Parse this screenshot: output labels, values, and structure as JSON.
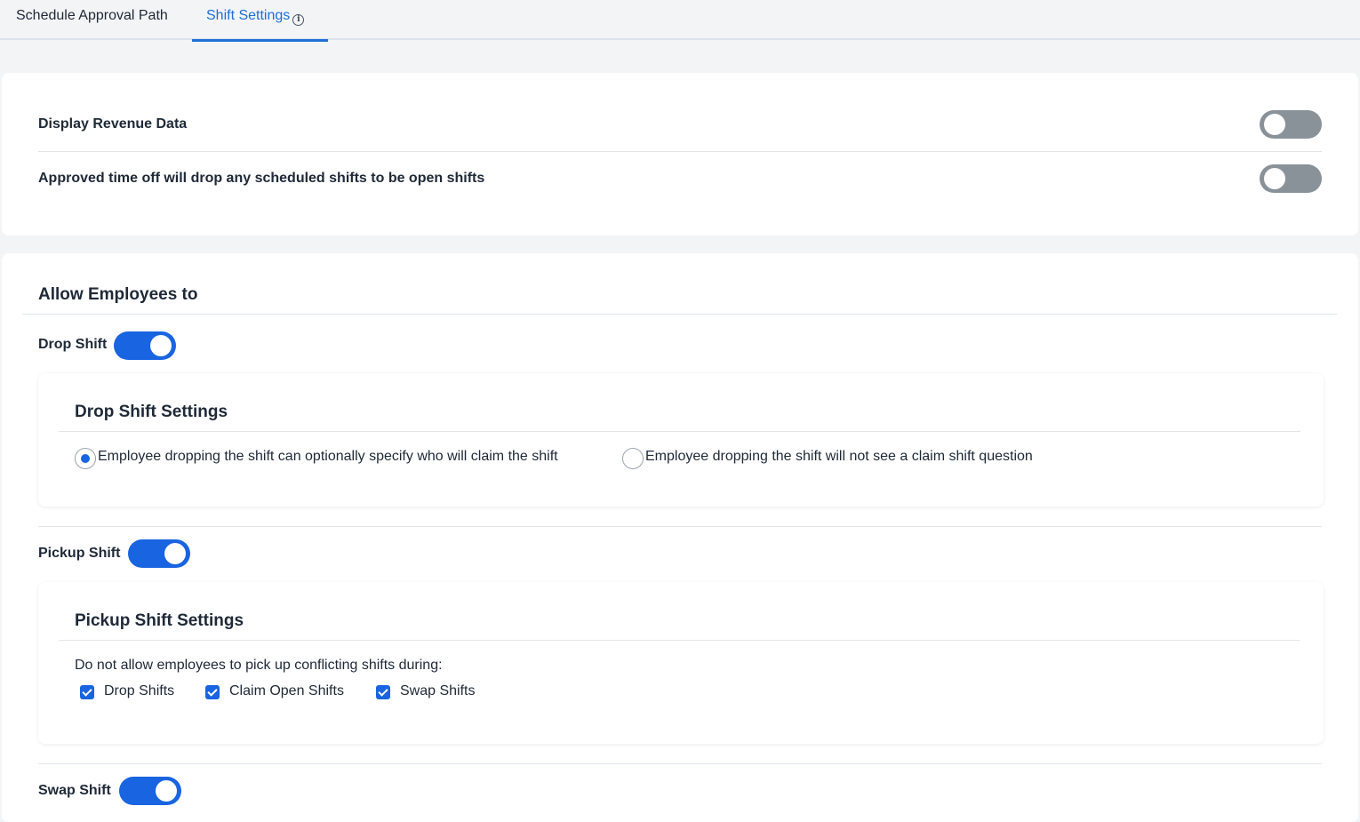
{
  "tabs": [
    {
      "label": "Schedule Approval Path"
    },
    {
      "label": "Shift Settings"
    }
  ],
  "info_icon": "info-icon",
  "general": {
    "display_revenue_label": "Display Revenue Data",
    "display_revenue_on": false,
    "time_off_label": "Approved time off will drop any scheduled shifts to be open shifts",
    "time_off_on": false
  },
  "allow": {
    "title": "Allow Employees to",
    "drop_shift": {
      "label": "Drop Shift",
      "on": true,
      "settings_title": "Drop Shift Settings",
      "options": [
        {
          "label": "Employee dropping the shift can optionally specify who will claim the shift",
          "selected": true
        },
        {
          "label": "Employee dropping the shift will not see a claim shift question",
          "selected": false
        }
      ]
    },
    "pickup_shift": {
      "label": "Pickup Shift",
      "on": true,
      "settings_title": "Pickup Shift Settings",
      "conflict_text": "Do not allow employees to pick up conflicting shifts during:",
      "checks": [
        {
          "label": "Drop Shifts",
          "checked": true
        },
        {
          "label": "Claim Open Shifts",
          "checked": true
        },
        {
          "label": "Swap Shifts",
          "checked": true
        }
      ]
    },
    "swap_shift": {
      "label": "Swap Shift",
      "on": true
    }
  },
  "colors": {
    "accent": "#1964e0",
    "toggle_off": "#8a9299",
    "tab_active": "#1f6fd6"
  }
}
